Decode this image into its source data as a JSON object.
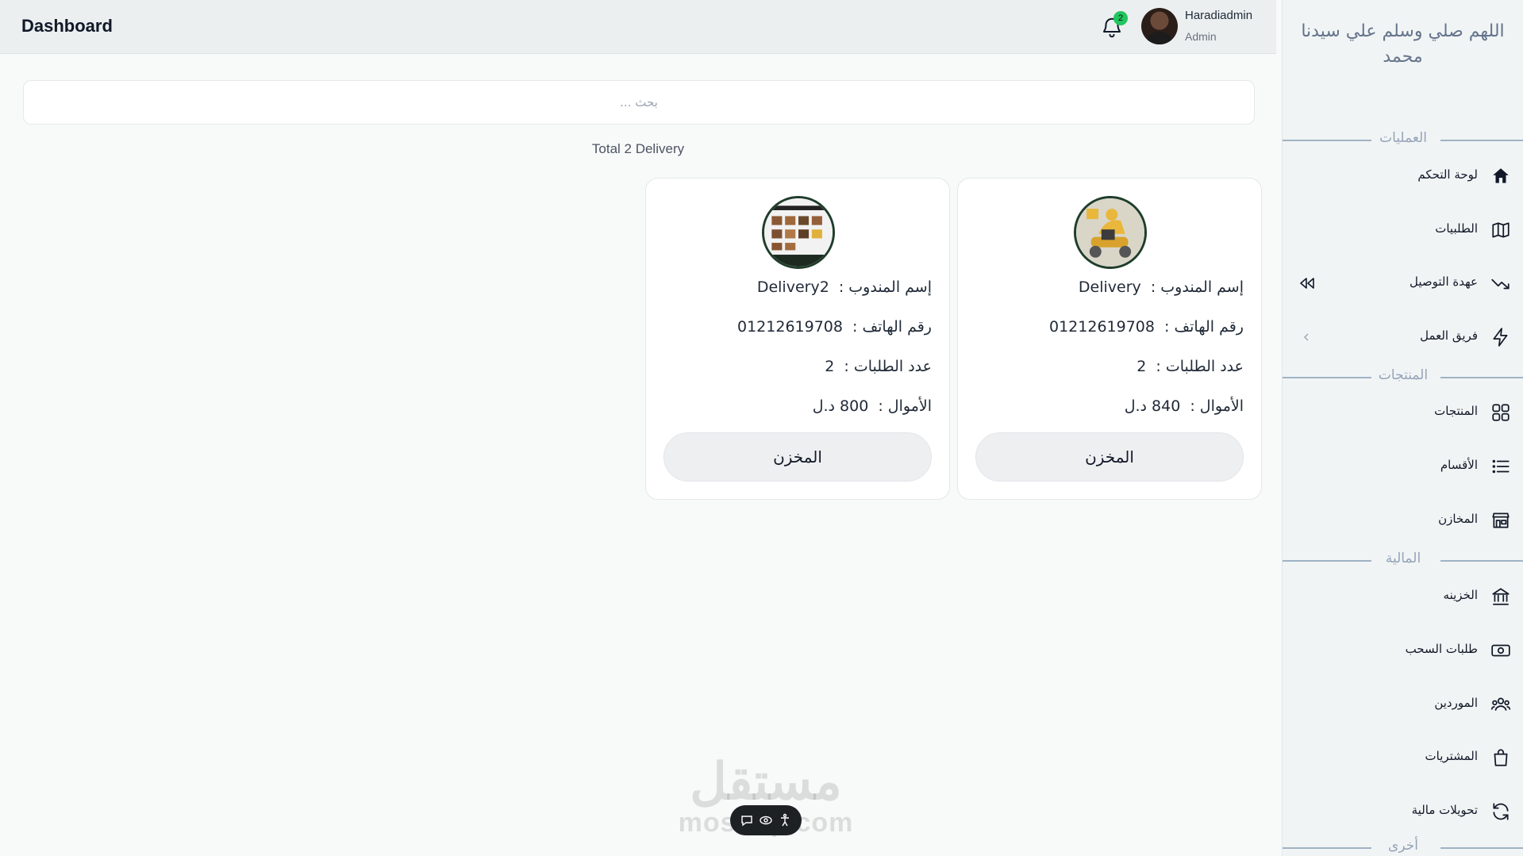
{
  "header": {
    "title": "Dashboard",
    "notification_count": "2",
    "user_name": "Haradiadmin",
    "user_role": "Admin"
  },
  "sidebar": {
    "brand": "اللهم صلي وسلم علي سيدنا محمد",
    "sections": {
      "operations": "العمليات",
      "products": "المنتجات",
      "finance": "المالية",
      "other": "أخرى"
    },
    "items": [
      {
        "label": "لوحة التحكم",
        "icon": "home-icon"
      },
      {
        "label": "الطلبيات",
        "icon": "map-icon"
      },
      {
        "label": "عهدة التوصيل",
        "icon": "trend-down-icon"
      },
      {
        "label": "فريق العمل",
        "icon": "bolt-icon"
      },
      {
        "label": "المنتجات",
        "icon": "grid-icon"
      },
      {
        "label": "الأقسام",
        "icon": "list-icon"
      },
      {
        "label": "المخازن",
        "icon": "store-icon"
      },
      {
        "label": "الخزينه",
        "icon": "bank-icon"
      },
      {
        "label": "طلبات السحب",
        "icon": "cash-icon"
      },
      {
        "label": "الموردين",
        "icon": "users-icon"
      },
      {
        "label": "المشتريات",
        "icon": "bag-icon"
      },
      {
        "label": "تحويلات مالية",
        "icon": "refresh-icon"
      }
    ]
  },
  "search": {
    "placeholder": "بحث ..."
  },
  "summary": {
    "total_text": "Total 2 Delivery"
  },
  "labels": {
    "name": "إسم المندوب :",
    "phone": "رقم الهاتف :",
    "orders": "عدد الطلبات :",
    "money": "الأموال :",
    "warehouse_button": "المخزن"
  },
  "deliveries": [
    {
      "name": "Delivery",
      "phone": "01212619708",
      "orders": "2",
      "money": "840 د.ل"
    },
    {
      "name": "Delivery2",
      "phone": "01212619708",
      "orders": "2",
      "money": "800 د.ل"
    }
  ],
  "watermark": {
    "arabic": "مستقل",
    "latin": "mostaql.com"
  },
  "colors": {
    "accent": "#22c55e",
    "sidebar_line": "#9fb3c3",
    "card_bg": "#ffffff"
  }
}
